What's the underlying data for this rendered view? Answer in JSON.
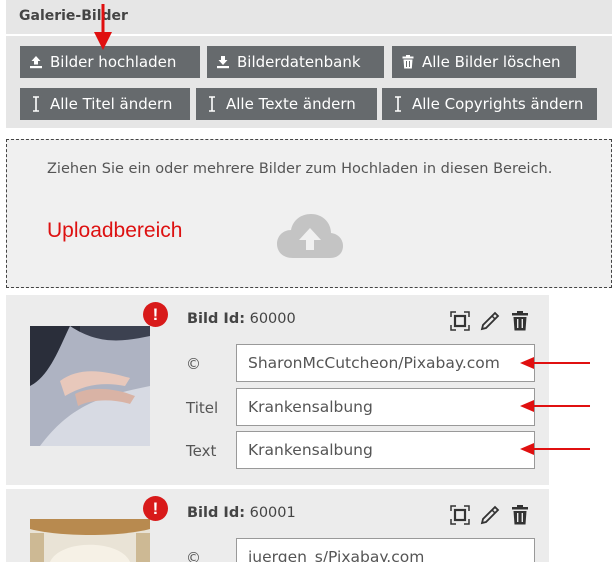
{
  "header": {
    "title": "Galerie-Bilder"
  },
  "toolbar": {
    "upload": "Bilder hochladen",
    "database": "Bilderdatenbank",
    "delete_all": "Alle Bilder löschen",
    "titles": "Alle Titel ändern",
    "texts": "Alle Texte ändern",
    "copyrights": "Alle Copyrights ändern"
  },
  "dropzone": {
    "hint": "Ziehen Sie ein oder mehrere Bilder zum Hochladen in diesen Bereich.",
    "label": "Uploadbereich",
    "icon": "cloud-upload-icon"
  },
  "cards": [
    {
      "id_label": "Bild Id:",
      "id_value": "60000",
      "warning": "!",
      "copyright_label": "©",
      "copyright_value": "SharonMcCutcheon/Pixabay.com",
      "title_label": "Titel",
      "title_value": "Krankensalbung",
      "text_label": "Text",
      "text_value": "Krankensalbung"
    },
    {
      "id_label": "Bild Id:",
      "id_value": "60001",
      "warning": "!",
      "copyright_label": "©",
      "copyright_value": "juergen_s/Pixabay.com"
    }
  ],
  "colors": {
    "button": "#666a6d",
    "annotation": "#dd1111",
    "warning": "#d81a1a",
    "panel": "#e6e6e6"
  }
}
